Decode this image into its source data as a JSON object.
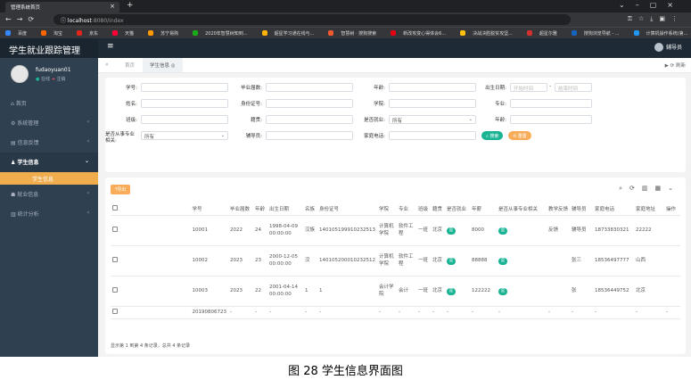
{
  "browser": {
    "tab_title": "管理系统首页",
    "url_host": "localhost",
    "url_path": ":8080/index",
    "bookmarks": [
      "百度",
      "淘宝",
      "京东",
      "天猫",
      "苏宁易购",
      "2020年智慧树知到...",
      "超星学习通在线与...",
      "智慧树 · 搜狗搜索",
      "新改攻变心得体会6...",
      "决战决胜脱贫攻坚...",
      "超星尔雅",
      "搜狗浏览导航 - ...",
      "计算机操作系统(第..."
    ],
    "bookmark_colors": [
      "#3388ff",
      "#ff6600",
      "#e1251b",
      "#ff0036",
      "#ff9900",
      "#1aad19",
      "#ffb400",
      "#f25830",
      "#e60012",
      "#ffc107",
      "#d32f2f",
      "#1565c0",
      "#2196f3"
    ]
  },
  "app": {
    "title": "学生就业跟踪管理",
    "header_user": "辅导员"
  },
  "profile": {
    "name": "fudaoyuan01",
    "online": "在线",
    "logout": "注销"
  },
  "sidebar": {
    "items": [
      {
        "label": "首页",
        "icon": "home-icon"
      },
      {
        "label": "系统管理",
        "icon": "gear-icon"
      },
      {
        "label": "信息反馈",
        "icon": "file-icon"
      },
      {
        "label": "学生信息",
        "icon": "users-icon"
      },
      {
        "label": "学生信息",
        "icon": ""
      },
      {
        "label": "就业信息",
        "icon": "paw-icon"
      },
      {
        "label": "统计分析",
        "icon": "bar-chart-icon"
      }
    ]
  },
  "tabs": {
    "home": "首页",
    "active": "学生信息",
    "right": "▶  ⟳ 刷新"
  },
  "search": {
    "fields": {
      "xuehao": "学号:",
      "biye": "毕业届数:",
      "nianling": "年龄:",
      "chusheng": "出生日期:",
      "start_ph": "开始时间",
      "end_ph": "结束时间",
      "xingming": "姓名:",
      "shenfen": "身份证号:",
      "xueyuan": "学院:",
      "zhuanye": "专业:",
      "banji": "班级:",
      "jiguan": "籍贯:",
      "jiuye": "是否就业:",
      "jiuye_value": "所有",
      "nianji": "年龄:",
      "congshi": "是否从事专业相关:",
      "congshi_value": "所有",
      "fudaoyuan": "辅导员:",
      "jiating": "家庭电话:"
    },
    "search_btn": "搜索",
    "reset_btn": "重置"
  },
  "table": {
    "export_label": "导出",
    "headers": [
      "学号",
      "毕业届数",
      "年龄",
      "出生日期",
      "名族",
      "身份证号",
      "学院",
      "专业",
      "班级",
      "籍贯",
      "是否就业",
      "年薪",
      "是否从事专业相关",
      "教学反馈",
      "辅导员",
      "家庭电话",
      "家庭地址",
      "操作"
    ],
    "rows": [
      {
        "xh": "10001",
        "jie": "2022",
        "age": "24",
        "birth": "1998-04-09 00:00:00",
        "mz": "汉族",
        "sfz": "140105199910232513",
        "xy": "计算机学院",
        "zy": "软件工程",
        "bj": "一班",
        "jg": "北京",
        "jy": "是",
        "nx": "8000",
        "xg": "是",
        "fk": "反馈",
        "fdy": "辅导员",
        "tel": "18733830321",
        "addr": "22222",
        "op": ""
      },
      {
        "xh": "10002",
        "jie": "2023",
        "age": "23",
        "birth": "2000-12-05 00:00:00",
        "mz": "汉",
        "sfz": "140105200010232512",
        "xy": "计算机学院",
        "zy": "软件工程",
        "bj": "一班",
        "jg": "北京",
        "jy": "是",
        "nx": "88888",
        "xg": "是",
        "fk": "",
        "fdy": "张三",
        "tel": "18536497777",
        "addr": "山西",
        "op": ""
      },
      {
        "xh": "10003",
        "jie": "2023",
        "age": "22",
        "birth": "2001-04-14 00:00:00",
        "mz": "1",
        "sfz": "1",
        "xy": "会计学院",
        "zy": "会计",
        "bj": "一班",
        "jg": "北京",
        "jy": "是",
        "nx": "122222",
        "xg": "是",
        "fk": "",
        "fdy": "张",
        "tel": "18536449752",
        "addr": "北京",
        "op": ""
      },
      {
        "xh": "20190806723",
        "jie": "-",
        "age": "-",
        "birth": "-",
        "mz": "-",
        "sfz": "-",
        "xy": "-",
        "zy": "-",
        "bj": "-",
        "jg": "-",
        "jy": "-",
        "nx": "-",
        "xg": "-",
        "fk": "-",
        "fdy": "-",
        "tel": "-",
        "addr": "-",
        "op": "-"
      }
    ],
    "pagination": "显示第 1 到第 4 条记录，总共 4 条记录"
  },
  "caption": "图 28 学生信息界面图"
}
